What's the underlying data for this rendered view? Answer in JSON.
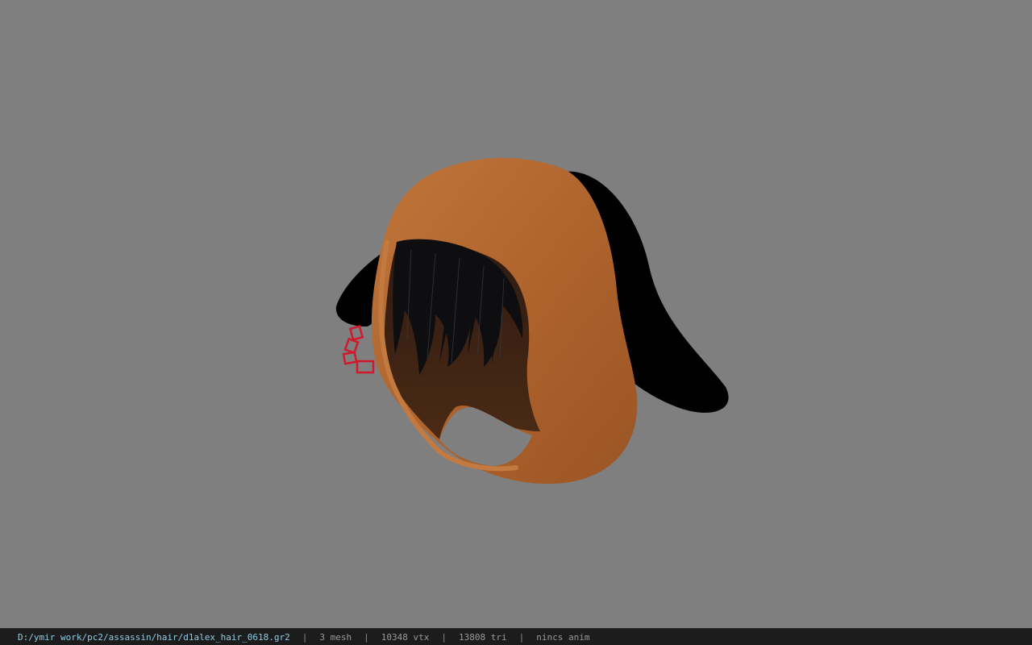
{
  "viewport": {
    "background_color": "#7f7f7f",
    "model": {
      "parts": [
        "hood",
        "hair",
        "ears",
        "chain"
      ],
      "colors": {
        "hood": "#b0652e",
        "hood_inner": "#3e2415",
        "hair": "#0e0e10",
        "ears": "#000000",
        "chain": "#d0182e"
      }
    }
  },
  "statusbar": {
    "file_path": "D:/ymir work/pc2/assassin/hair/d1alex_hair_0618.gr2",
    "separator": "|",
    "mesh_count": "3 mesh",
    "vertex_count": "10348 vtx",
    "triangle_count": "13808 tri",
    "anim_status": "nincs anim"
  }
}
